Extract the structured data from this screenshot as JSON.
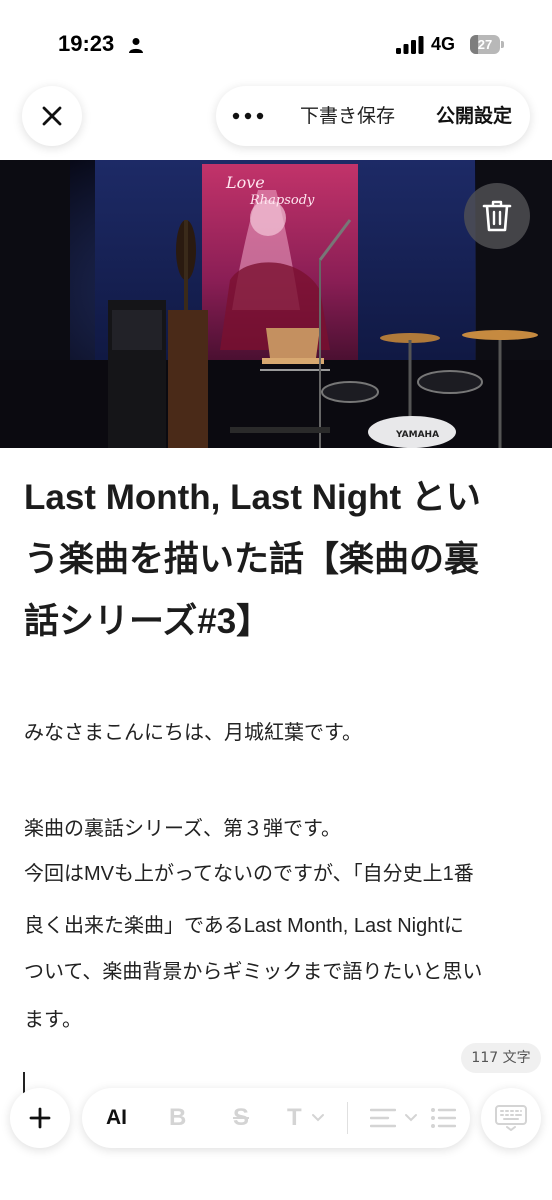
{
  "status_bar": {
    "time": "19:23",
    "network": "4G",
    "battery_level": "27",
    "battery_fraction": 0.27
  },
  "toolbar": {
    "draft_label": "下書き保存",
    "publish_label": "公開設定"
  },
  "hero": {
    "poster_title_line1": "Love",
    "poster_title_line2": "Rhapsody",
    "drum_brand": "YAMAHA"
  },
  "article": {
    "title_lines": [
      "Last Month, Last Night とい",
      "う楽曲を描いた話【楽曲の裏",
      "話シリーズ#3】"
    ],
    "body_lines": [
      "みなさまこんにちは、月城紅葉です。",
      "楽曲の裏話シリーズ、第３弾です。",
      "今回はMVも上がってないのですが、「自分史上1番",
      "良く出来た楽曲」であるLast Month, Last Nightに",
      "ついて、楽曲背景からギミックまで語りたいと思い",
      "ます。"
    ],
    "char_count": "117 文字"
  },
  "format_bar": {
    "ai_label": "AI",
    "bold_label": "B",
    "strike_label": "S",
    "heading_label": "T"
  }
}
